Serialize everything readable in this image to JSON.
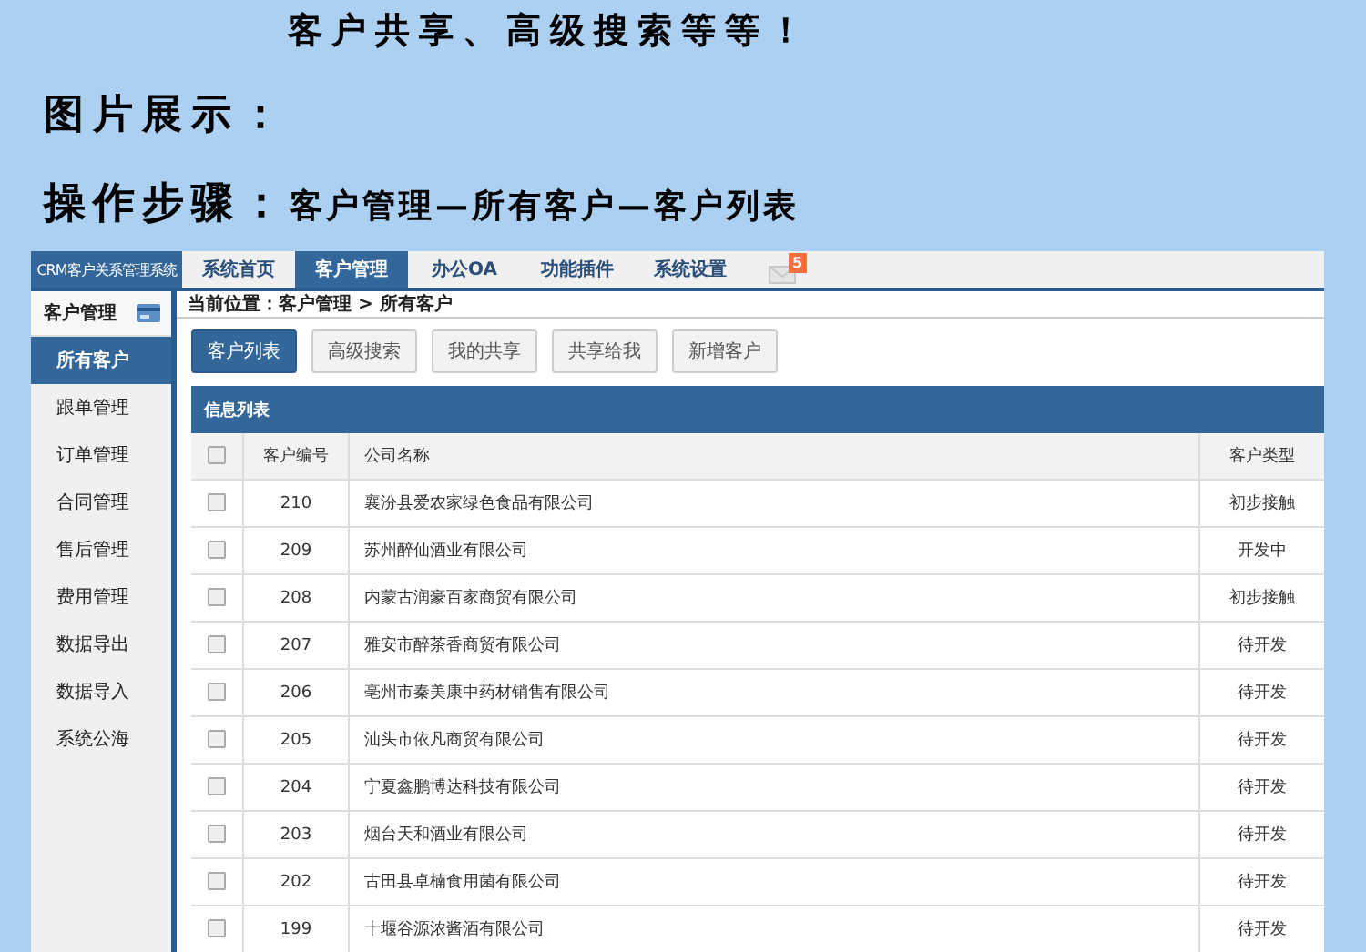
{
  "intro": {
    "headline": "客户共享、高级搜索等等！",
    "section_label": "图片展示：",
    "steps_label": "操作步骤：",
    "steps": "客户管理—所有客户—客户列表"
  },
  "app": {
    "brand": "CRM客户关系管理系统",
    "nav_tabs": [
      {
        "label": "系统首页",
        "selected": false
      },
      {
        "label": "客户管理",
        "selected": true
      },
      {
        "label": "办公OA",
        "selected": false
      },
      {
        "label": "功能插件",
        "selected": false
      },
      {
        "label": "系统设置",
        "selected": false
      }
    ],
    "mail_badge": "5",
    "sidebar": {
      "title": "客户管理",
      "items": [
        {
          "label": "所有客户",
          "selected": true
        },
        {
          "label": "跟单管理",
          "selected": false
        },
        {
          "label": "订单管理",
          "selected": false
        },
        {
          "label": "合同管理",
          "selected": false
        },
        {
          "label": "售后管理",
          "selected": false
        },
        {
          "label": "费用管理",
          "selected": false
        },
        {
          "label": "数据导出",
          "selected": false
        },
        {
          "label": "数据导入",
          "selected": false
        },
        {
          "label": "系统公海",
          "selected": false
        }
      ]
    },
    "breadcrumb": "当前位置：客户管理 > 所有客户",
    "buttons": [
      {
        "label": "客户列表",
        "selected": true
      },
      {
        "label": "高级搜索",
        "selected": false
      },
      {
        "label": "我的共享",
        "selected": false
      },
      {
        "label": "共享给我",
        "selected": false
      },
      {
        "label": "新增客户",
        "selected": false
      }
    ],
    "panel_title": "信息列表",
    "table": {
      "select_all_checked": false,
      "columns": [
        "客户编号",
        "公司名称",
        "客户类型"
      ],
      "rows": [
        {
          "checked": false,
          "id": "210",
          "company": "襄汾县爱农家绿色食品有限公司",
          "type": "初步接触"
        },
        {
          "checked": false,
          "id": "209",
          "company": "苏州醉仙酒业有限公司",
          "type": "开发中"
        },
        {
          "checked": false,
          "id": "208",
          "company": "内蒙古润豪百家商贸有限公司",
          "type": "初步接触"
        },
        {
          "checked": false,
          "id": "207",
          "company": "雅安市醉茶香商贸有限公司",
          "type": "待开发"
        },
        {
          "checked": false,
          "id": "206",
          "company": "亳州市秦美康中药材销售有限公司",
          "type": "待开发"
        },
        {
          "checked": false,
          "id": "205",
          "company": "汕头市依凡商贸有限公司",
          "type": "待开发"
        },
        {
          "checked": false,
          "id": "204",
          "company": "宁夏鑫鹏博达科技有限公司",
          "type": "待开发"
        },
        {
          "checked": false,
          "id": "203",
          "company": "烟台天和酒业有限公司",
          "type": "待开发"
        },
        {
          "checked": false,
          "id": "202",
          "company": "古田县卓楠食用菌有限公司",
          "type": "待开发"
        },
        {
          "checked": false,
          "id": "199",
          "company": "十堰谷源浓酱酒有限公司",
          "type": "待开发"
        }
      ]
    }
  }
}
